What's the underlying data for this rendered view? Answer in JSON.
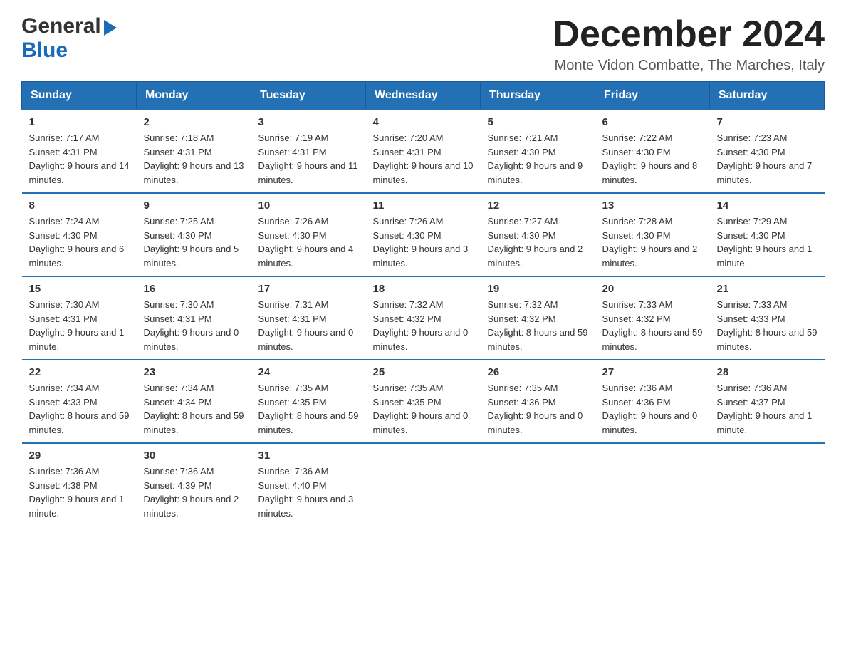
{
  "header": {
    "logo": {
      "general": "General",
      "blue": "Blue",
      "arrow_color": "#1a6bba"
    },
    "month_title": "December 2024",
    "location": "Monte Vidon Combatte, The Marches, Italy"
  },
  "weekdays": [
    "Sunday",
    "Monday",
    "Tuesday",
    "Wednesday",
    "Thursday",
    "Friday",
    "Saturday"
  ],
  "weeks": [
    [
      {
        "day": "1",
        "sunrise": "7:17 AM",
        "sunset": "4:31 PM",
        "daylight": "9 hours and 14 minutes."
      },
      {
        "day": "2",
        "sunrise": "7:18 AM",
        "sunset": "4:31 PM",
        "daylight": "9 hours and 13 minutes."
      },
      {
        "day": "3",
        "sunrise": "7:19 AM",
        "sunset": "4:31 PM",
        "daylight": "9 hours and 11 minutes."
      },
      {
        "day": "4",
        "sunrise": "7:20 AM",
        "sunset": "4:31 PM",
        "daylight": "9 hours and 10 minutes."
      },
      {
        "day": "5",
        "sunrise": "7:21 AM",
        "sunset": "4:30 PM",
        "daylight": "9 hours and 9 minutes."
      },
      {
        "day": "6",
        "sunrise": "7:22 AM",
        "sunset": "4:30 PM",
        "daylight": "9 hours and 8 minutes."
      },
      {
        "day": "7",
        "sunrise": "7:23 AM",
        "sunset": "4:30 PM",
        "daylight": "9 hours and 7 minutes."
      }
    ],
    [
      {
        "day": "8",
        "sunrise": "7:24 AM",
        "sunset": "4:30 PM",
        "daylight": "9 hours and 6 minutes."
      },
      {
        "day": "9",
        "sunrise": "7:25 AM",
        "sunset": "4:30 PM",
        "daylight": "9 hours and 5 minutes."
      },
      {
        "day": "10",
        "sunrise": "7:26 AM",
        "sunset": "4:30 PM",
        "daylight": "9 hours and 4 minutes."
      },
      {
        "day": "11",
        "sunrise": "7:26 AM",
        "sunset": "4:30 PM",
        "daylight": "9 hours and 3 minutes."
      },
      {
        "day": "12",
        "sunrise": "7:27 AM",
        "sunset": "4:30 PM",
        "daylight": "9 hours and 2 minutes."
      },
      {
        "day": "13",
        "sunrise": "7:28 AM",
        "sunset": "4:30 PM",
        "daylight": "9 hours and 2 minutes."
      },
      {
        "day": "14",
        "sunrise": "7:29 AM",
        "sunset": "4:30 PM",
        "daylight": "9 hours and 1 minute."
      }
    ],
    [
      {
        "day": "15",
        "sunrise": "7:30 AM",
        "sunset": "4:31 PM",
        "daylight": "9 hours and 1 minute."
      },
      {
        "day": "16",
        "sunrise": "7:30 AM",
        "sunset": "4:31 PM",
        "daylight": "9 hours and 0 minutes."
      },
      {
        "day": "17",
        "sunrise": "7:31 AM",
        "sunset": "4:31 PM",
        "daylight": "9 hours and 0 minutes."
      },
      {
        "day": "18",
        "sunrise": "7:32 AM",
        "sunset": "4:32 PM",
        "daylight": "9 hours and 0 minutes."
      },
      {
        "day": "19",
        "sunrise": "7:32 AM",
        "sunset": "4:32 PM",
        "daylight": "8 hours and 59 minutes."
      },
      {
        "day": "20",
        "sunrise": "7:33 AM",
        "sunset": "4:32 PM",
        "daylight": "8 hours and 59 minutes."
      },
      {
        "day": "21",
        "sunrise": "7:33 AM",
        "sunset": "4:33 PM",
        "daylight": "8 hours and 59 minutes."
      }
    ],
    [
      {
        "day": "22",
        "sunrise": "7:34 AM",
        "sunset": "4:33 PM",
        "daylight": "8 hours and 59 minutes."
      },
      {
        "day": "23",
        "sunrise": "7:34 AM",
        "sunset": "4:34 PM",
        "daylight": "8 hours and 59 minutes."
      },
      {
        "day": "24",
        "sunrise": "7:35 AM",
        "sunset": "4:35 PM",
        "daylight": "8 hours and 59 minutes."
      },
      {
        "day": "25",
        "sunrise": "7:35 AM",
        "sunset": "4:35 PM",
        "daylight": "9 hours and 0 minutes."
      },
      {
        "day": "26",
        "sunrise": "7:35 AM",
        "sunset": "4:36 PM",
        "daylight": "9 hours and 0 minutes."
      },
      {
        "day": "27",
        "sunrise": "7:36 AM",
        "sunset": "4:36 PM",
        "daylight": "9 hours and 0 minutes."
      },
      {
        "day": "28",
        "sunrise": "7:36 AM",
        "sunset": "4:37 PM",
        "daylight": "9 hours and 1 minute."
      }
    ],
    [
      {
        "day": "29",
        "sunrise": "7:36 AM",
        "sunset": "4:38 PM",
        "daylight": "9 hours and 1 minute."
      },
      {
        "day": "30",
        "sunrise": "7:36 AM",
        "sunset": "4:39 PM",
        "daylight": "9 hours and 2 minutes."
      },
      {
        "day": "31",
        "sunrise": "7:36 AM",
        "sunset": "4:40 PM",
        "daylight": "9 hours and 3 minutes."
      },
      null,
      null,
      null,
      null
    ]
  ],
  "labels": {
    "sunrise": "Sunrise:",
    "sunset": "Sunset:",
    "daylight": "Daylight:"
  }
}
